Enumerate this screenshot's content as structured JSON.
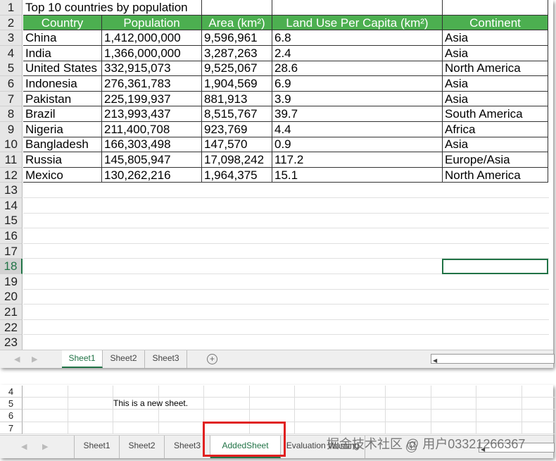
{
  "sheet1": {
    "title": "Top 10 countries by population",
    "headers": [
      "Country",
      "Population",
      "Area (km²)",
      "Land Use Per Capita (km²)",
      "Continent"
    ],
    "rows": [
      [
        "China",
        "1,412,000,000",
        "9,596,961",
        "6.8",
        "Asia"
      ],
      [
        "India",
        "1,366,000,000",
        "3,287,263",
        "2.4",
        "Asia"
      ],
      [
        "United States",
        "332,915,073",
        "9,525,067",
        "28.6",
        "North America"
      ],
      [
        "Indonesia",
        "276,361,783",
        "1,904,569",
        "6.9",
        "Asia"
      ],
      [
        "Pakistan",
        "225,199,937",
        "881,913",
        "3.9",
        "Asia"
      ],
      [
        "Brazil",
        "213,993,437",
        "8,515,767",
        "39.7",
        "South America"
      ],
      [
        "Nigeria",
        "211,400,708",
        "923,769",
        "4.4",
        "Africa"
      ],
      [
        "Bangladesh",
        "166,303,498",
        "147,570",
        "0.9",
        "Asia"
      ],
      [
        "Russia",
        "145,805,947",
        "17,098,242",
        "117.2",
        "Europe/Asia"
      ],
      [
        "Mexico",
        "130,262,216",
        "1,964,375",
        "15.1",
        "North America"
      ]
    ],
    "row_numbers": [
      "1",
      "2",
      "3",
      "4",
      "5",
      "6",
      "7",
      "8",
      "9",
      "10",
      "11",
      "12",
      "13",
      "14",
      "15",
      "16",
      "17",
      "18",
      "19",
      "20",
      "21",
      "22",
      "23"
    ],
    "selected_row": "18",
    "tabs": [
      "Sheet1",
      "Sheet2",
      "Sheet3"
    ],
    "active_tab": "Sheet1"
  },
  "sheet2": {
    "row_numbers": [
      "4",
      "5",
      "6",
      "7"
    ],
    "cell_text": "This is a new sheet.",
    "tabs": [
      "Sheet1",
      "Sheet2",
      "Sheet3",
      "AddedSheet",
      "Evaluation Warning"
    ],
    "active_tab": "AddedSheet",
    "highlight_color": "#e02020"
  },
  "watermark": "掘金技术社区 @ 用户03321266367",
  "colors": {
    "header_green": "#4caf50",
    "excel_green": "#217346"
  }
}
